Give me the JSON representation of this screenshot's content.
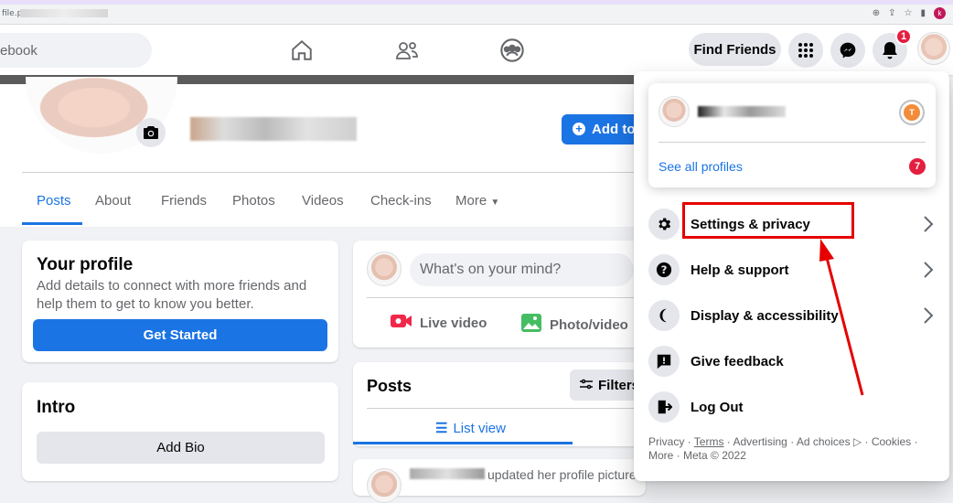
{
  "browser": {
    "url_prefix": "file.p",
    "avatar_letter": "k"
  },
  "topnav": {
    "search_text": "ebook",
    "find_friends_label": "Find Friends",
    "notification_count": "1",
    "icons": [
      "home-icon",
      "friends-icon",
      "groups-icon",
      "menu-grid-icon",
      "messenger-icon",
      "bell-icon"
    ]
  },
  "profile": {
    "add_story_label": "Add to",
    "tabs": [
      "Posts",
      "About",
      "Friends",
      "Photos",
      "Videos",
      "Check-ins",
      "More"
    ]
  },
  "your_profile_card": {
    "title": "Your profile",
    "text": "Add details to connect with more friends and help them to get to know you better.",
    "button": "Get Started"
  },
  "intro_card": {
    "title": "Intro",
    "button": "Add Bio"
  },
  "composer": {
    "placeholder": "What's on your mind?",
    "live_video": "Live video",
    "photo_video": "Photo/video"
  },
  "posts_card": {
    "title": "Posts",
    "filters": "Filters",
    "list_view": "List view",
    "first_post_text": "updated her profile picture."
  },
  "account_menu": {
    "see_all_profiles": "See all profiles",
    "profiles_badge": "7",
    "switch_avatar_letter": "T",
    "items": [
      {
        "label": "Settings & privacy",
        "icon": "gear-icon",
        "chevron": true
      },
      {
        "label": "Help & support",
        "icon": "question-icon",
        "chevron": true
      },
      {
        "label": "Display & accessibility",
        "icon": "moon-icon",
        "chevron": true
      },
      {
        "label": "Give feedback",
        "icon": "feedback-icon",
        "chevron": false
      },
      {
        "label": "Log Out",
        "icon": "logout-icon",
        "chevron": false
      }
    ],
    "footer": {
      "privacy": "Privacy",
      "terms": "Terms",
      "advertising": "Advertising",
      "ad_choices": "Ad choices",
      "cookies": "Cookies",
      "more": "More",
      "meta": "Meta © 2022"
    }
  },
  "colors": {
    "accent": "#1b74e4",
    "annotation": "#e60000",
    "badge": "#e41e3f"
  }
}
